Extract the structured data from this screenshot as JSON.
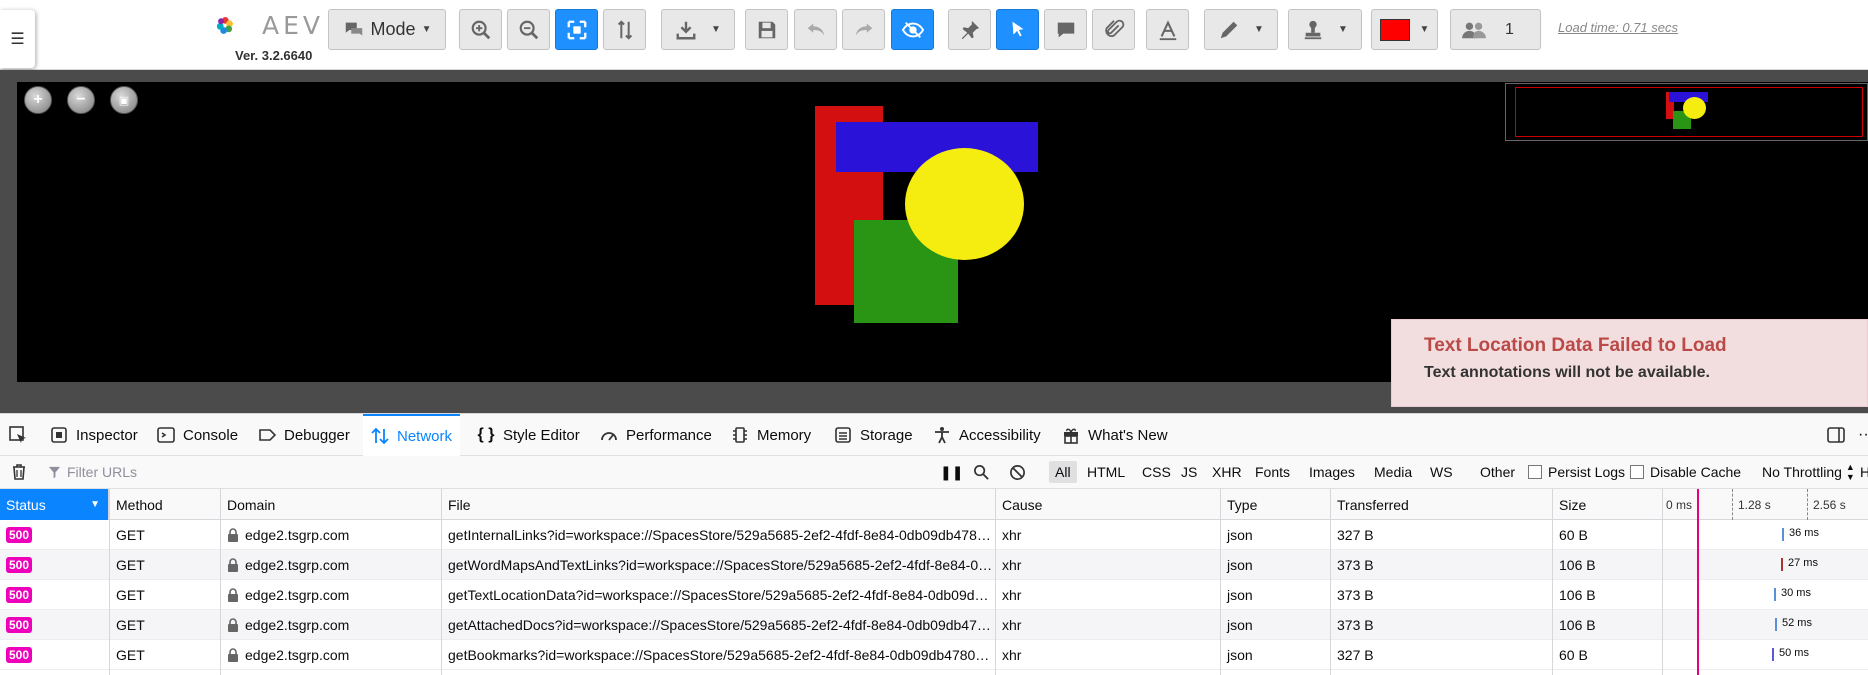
{
  "app": {
    "logo_text": "AEV",
    "version": "Ver. 3.2.6640",
    "mode_label": "Mode",
    "user_count": "1",
    "load_time": "Load time: 0.71 secs",
    "annotation_color": "#ff0000"
  },
  "toast": {
    "title": "Text Location Data Failed to Load",
    "message": "Text annotations will not be available."
  },
  "devtools": {
    "tabs": [
      {
        "label": "Inspector",
        "icon": "inspector-icon"
      },
      {
        "label": "Console",
        "icon": "console-icon"
      },
      {
        "label": "Debugger",
        "icon": "debugger-icon"
      },
      {
        "label": "Network",
        "icon": "network-icon",
        "selected": true
      },
      {
        "label": "Style Editor",
        "icon": "style-editor-icon"
      },
      {
        "label": "Performance",
        "icon": "performance-icon"
      },
      {
        "label": "Memory",
        "icon": "memory-icon"
      },
      {
        "label": "Storage",
        "icon": "storage-icon"
      },
      {
        "label": "Accessibility",
        "icon": "accessibility-icon"
      },
      {
        "label": "What's New",
        "icon": "gift-icon"
      }
    ],
    "filter": {
      "placeholder": "Filter URLs",
      "types": [
        "All",
        "HTML",
        "CSS",
        "JS",
        "XHR",
        "Fonts",
        "Images",
        "Media",
        "WS",
        "Other"
      ],
      "selected_type": "All",
      "persist_logs": "Persist Logs",
      "disable_cache": "Disable Cache",
      "throttling": "No Throttling",
      "throttling_suffix": "H"
    },
    "columns": {
      "status": "Status",
      "method": "Method",
      "domain": "Domain",
      "file": "File",
      "cause": "Cause",
      "type": "Type",
      "transferred": "Transferred",
      "size": "Size"
    },
    "waterfall_ticks": [
      "0 ms",
      "1.28 s",
      "2.56 s"
    ],
    "requests": [
      {
        "status": "500",
        "method": "GET",
        "domain": "edge2.tsgrp.com",
        "file": "getInternalLinks?id=workspace://SpacesStore/529a5685-2ef2-4fdf-8e84-0db09db478…",
        "cause": "xhr",
        "type": "json",
        "transferred": "327 B",
        "size": "60 B",
        "time": "36 ms"
      },
      {
        "status": "500",
        "method": "GET",
        "domain": "edge2.tsgrp.com",
        "file": "getWordMapsAndTextLinks?id=workspace://SpacesStore/529a5685-2ef2-4fdf-8e84-0…",
        "cause": "xhr",
        "type": "json",
        "transferred": "373 B",
        "size": "106 B",
        "time": "27 ms"
      },
      {
        "status": "500",
        "method": "GET",
        "domain": "edge2.tsgrp.com",
        "file": "getTextLocationData?id=workspace://SpacesStore/529a5685-2ef2-4fdf-8e84-0db09d…",
        "cause": "xhr",
        "type": "json",
        "transferred": "373 B",
        "size": "106 B",
        "time": "30 ms"
      },
      {
        "status": "500",
        "method": "GET",
        "domain": "edge2.tsgrp.com",
        "file": "getAttachedDocs?id=workspace://SpacesStore/529a5685-2ef2-4fdf-8e84-0db09db47…",
        "cause": "xhr",
        "type": "json",
        "transferred": "373 B",
        "size": "106 B",
        "time": "52 ms"
      },
      {
        "status": "500",
        "method": "GET",
        "domain": "edge2.tsgrp.com",
        "file": "getBookmarks?id=workspace://SpacesStore/529a5685-2ef2-4fdf-8e84-0db09db4780…",
        "cause": "xhr",
        "type": "json",
        "transferred": "327 B",
        "size": "60 B",
        "time": "50 ms"
      }
    ]
  }
}
